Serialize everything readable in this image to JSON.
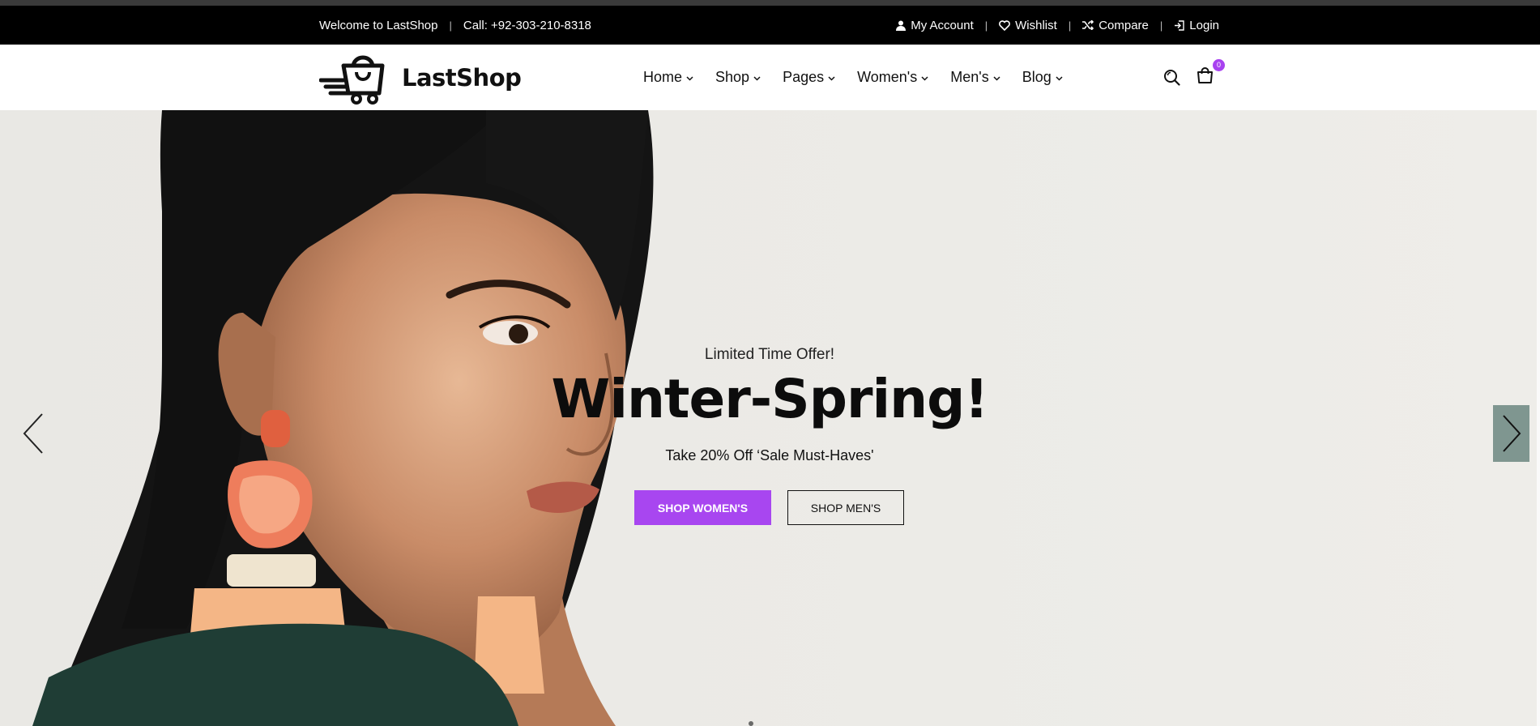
{
  "topbar": {
    "welcome": "Welcome to LastShop",
    "phone": "Call: +92-303-210-8318",
    "links": [
      {
        "label": "My Account",
        "icon": "user-icon"
      },
      {
        "label": "Wishlist",
        "icon": "heart-icon"
      },
      {
        "label": "Compare",
        "icon": "shuffle-icon"
      },
      {
        "label": "Login",
        "icon": "login-icon"
      }
    ]
  },
  "header": {
    "logo_text": "LastShop",
    "nav": [
      "Home",
      "Shop",
      "Pages",
      "Women's",
      "Men's",
      "Blog"
    ],
    "cart_count": "0"
  },
  "hero": {
    "kicker": "Limited Time Offer!",
    "headline": "Winter-Spring!",
    "subline": "Take 20% Off ‘Sale Must-Haves'",
    "primary_button": "SHOP WOMEN'S",
    "secondary_button": "SHOP MEN'S"
  },
  "colors": {
    "accent": "#a846f0",
    "topbar_bg": "#000000",
    "hero_bg": "#ecebe7",
    "arrow_bg": "#7f9690"
  }
}
